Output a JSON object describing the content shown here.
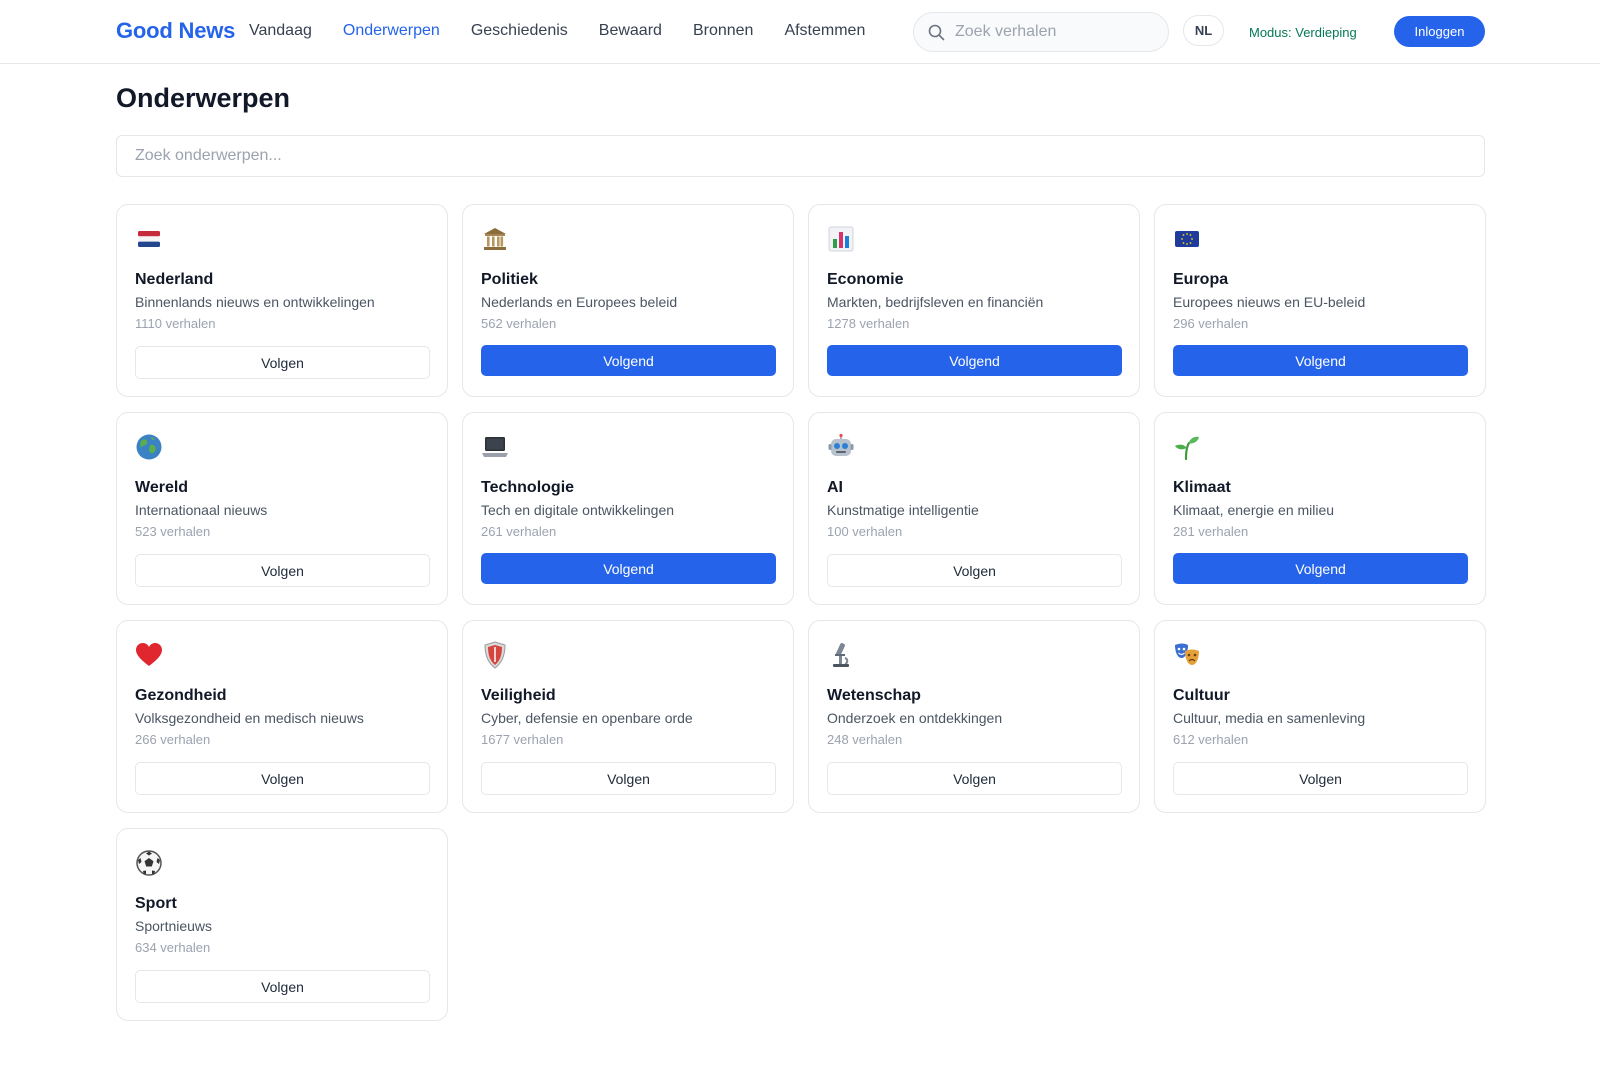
{
  "header": {
    "brand": "Good News",
    "nav": [
      {
        "label": "Vandaag",
        "active": false
      },
      {
        "label": "Onderwerpen",
        "active": true
      },
      {
        "label": "Geschiedenis",
        "active": false
      },
      {
        "label": "Bewaard",
        "active": false
      },
      {
        "label": "Bronnen",
        "active": false
      },
      {
        "label": "Afstemmen",
        "active": false
      }
    ],
    "search_placeholder": "Zoek verhalen",
    "language": "NL",
    "mode": "Modus: Verdieping",
    "login_label": "Inloggen"
  },
  "main": {
    "title": "Onderwerpen",
    "search_placeholder": "Zoek onderwerpen...",
    "topics": [
      {
        "icon": "netherlands-flag-icon",
        "name": "Nederland",
        "description": "Binnenlands nieuws en ontwikkelingen",
        "count": "1110 verhalen",
        "following": false,
        "button": "Volgen"
      },
      {
        "icon": "classical-building-icon",
        "name": "Politiek",
        "description": "Nederlands en Europees beleid",
        "count": "562 verhalen",
        "following": true,
        "button": "Volgend"
      },
      {
        "icon": "bar-chart-icon",
        "name": "Economie",
        "description": "Markten, bedrijfsleven en financiën",
        "count": "1278 verhalen",
        "following": true,
        "button": "Volgend"
      },
      {
        "icon": "eu-flag-icon",
        "name": "Europa",
        "description": "Europees nieuws en EU-beleid",
        "count": "296 verhalen",
        "following": true,
        "button": "Volgend"
      },
      {
        "icon": "globe-icon",
        "name": "Wereld",
        "description": "Internationaal nieuws",
        "count": "523 verhalen",
        "following": false,
        "button": "Volgen"
      },
      {
        "icon": "laptop-icon",
        "name": "Technologie",
        "description": "Tech en digitale ontwikkelingen",
        "count": "261 verhalen",
        "following": true,
        "button": "Volgend"
      },
      {
        "icon": "robot-icon",
        "name": "AI",
        "description": "Kunstmatige intelligentie",
        "count": "100 verhalen",
        "following": false,
        "button": "Volgen"
      },
      {
        "icon": "seedling-icon",
        "name": "Klimaat",
        "description": "Klimaat, energie en milieu",
        "count": "281 verhalen",
        "following": true,
        "button": "Volgend"
      },
      {
        "icon": "heart-icon",
        "name": "Gezondheid",
        "description": "Volksgezondheid en medisch nieuws",
        "count": "266 verhalen",
        "following": false,
        "button": "Volgen"
      },
      {
        "icon": "shield-icon",
        "name": "Veiligheid",
        "description": "Cyber, defensie en openbare orde",
        "count": "1677 verhalen",
        "following": false,
        "button": "Volgen"
      },
      {
        "icon": "microscope-icon",
        "name": "Wetenschap",
        "description": "Onderzoek en ontdekkingen",
        "count": "248 verhalen",
        "following": false,
        "button": "Volgen"
      },
      {
        "icon": "theater-masks-icon",
        "name": "Cultuur",
        "description": "Cultuur, media en samenleving",
        "count": "612 verhalen",
        "following": false,
        "button": "Volgen"
      },
      {
        "icon": "soccer-ball-icon",
        "name": "Sport",
        "description": "Sportnieuws",
        "count": "634 verhalen",
        "following": false,
        "button": "Volgen"
      }
    ]
  },
  "colors": {
    "accent": "#2563eb",
    "mode_text": "#047857",
    "border": "#e5e7eb",
    "muted_text": "#9ca3af"
  }
}
